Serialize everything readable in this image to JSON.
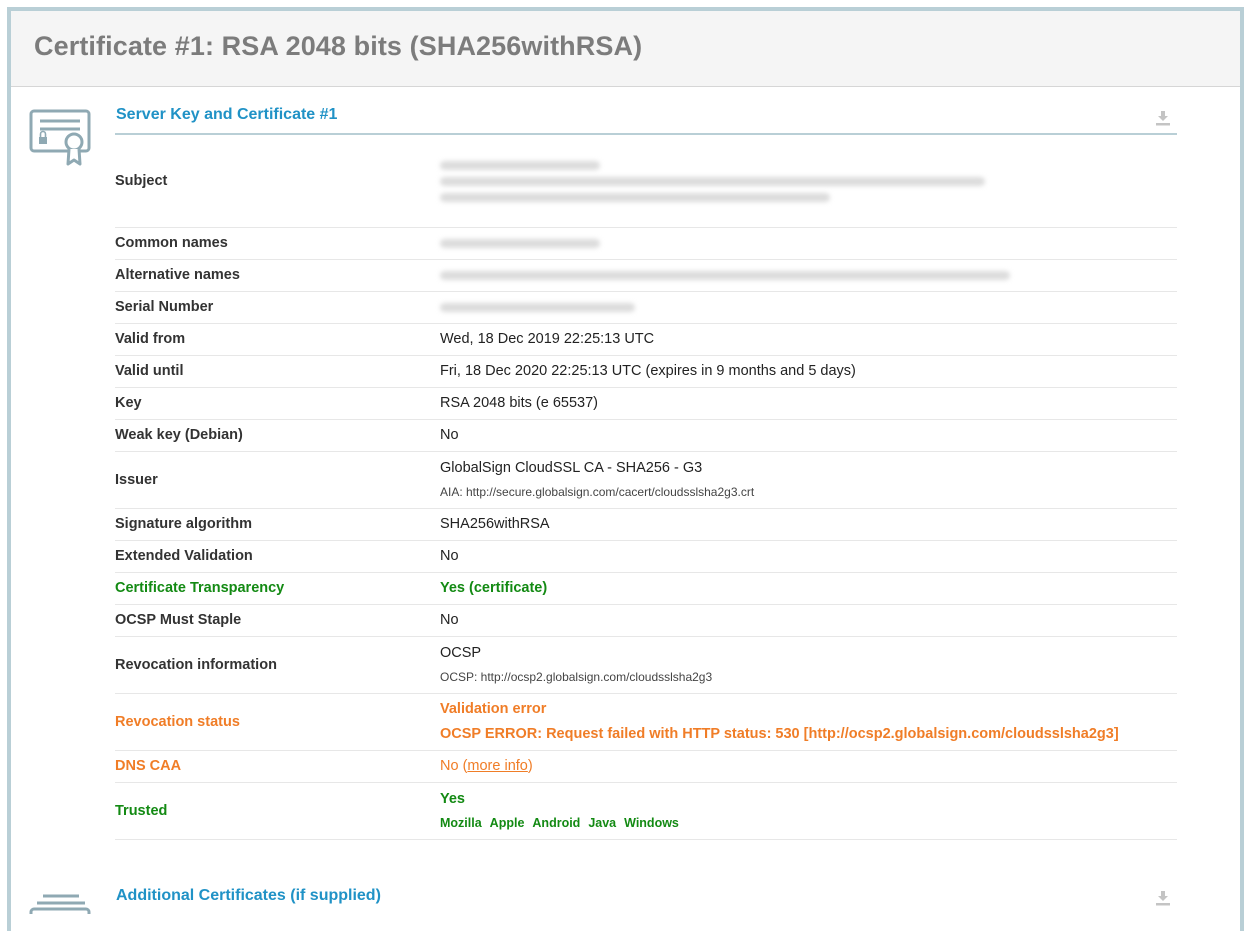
{
  "header": {
    "title": "Certificate #1: RSA 2048 bits (SHA256withRSA)"
  },
  "section": {
    "title": "Server Key and Certificate #1"
  },
  "section2": {
    "title": "Additional Certificates (if supplied)"
  },
  "rows": {
    "subject": {
      "label": "Subject"
    },
    "common_names": {
      "label": "Common names"
    },
    "alternative_names": {
      "label": "Alternative names"
    },
    "serial_number": {
      "label": "Serial Number"
    },
    "valid_from": {
      "label": "Valid from",
      "value": "Wed, 18 Dec 2019 22:25:13 UTC"
    },
    "valid_until": {
      "label": "Valid until",
      "value": "Fri, 18 Dec 2020 22:25:13 UTC (expires in 9 months and 5 days)"
    },
    "key": {
      "label": "Key",
      "value": "RSA 2048 bits (e 65537)"
    },
    "weak_key": {
      "label": "Weak key (Debian)",
      "value": "No"
    },
    "issuer": {
      "label": "Issuer",
      "value": "GlobalSign CloudSSL CA - SHA256 - G3",
      "sub": "AIA: http://secure.globalsign.com/cacert/cloudsslsha2g3.crt"
    },
    "signature_algorithm": {
      "label": "Signature algorithm",
      "value": "SHA256withRSA"
    },
    "extended_validation": {
      "label": "Extended Validation",
      "value": "No"
    },
    "certificate_transparency": {
      "label": "Certificate Transparency",
      "value": "Yes (certificate)"
    },
    "ocsp_must_staple": {
      "label": "OCSP Must Staple",
      "value": "No"
    },
    "revocation_information": {
      "label": "Revocation information",
      "value": "OCSP",
      "sub": "OCSP: http://ocsp2.globalsign.com/cloudsslsha2g3"
    },
    "revocation_status": {
      "label": "Revocation status",
      "value": "Validation error",
      "value2": "OCSP ERROR: Request failed with HTTP status: 530 [http://ocsp2.globalsign.com/cloudsslsha2g3]"
    },
    "dns_caa": {
      "label": "DNS CAA",
      "value_prefix": "No (",
      "link": "more info",
      "value_suffix": ")"
    },
    "trusted": {
      "label": "Trusted",
      "value": "Yes",
      "stores": [
        "Mozilla",
        "Apple",
        "Android",
        "Java",
        "Windows"
      ]
    }
  },
  "colors": {
    "accent": "#2092c6",
    "green": "#138a13",
    "orange": "#f07d27",
    "frame": "#b9cfd6",
    "header_text": "#7c7c7c"
  },
  "icons": {
    "certificate": "certificate-icon",
    "download": "download-icon",
    "stack": "certificate-stack-icon"
  }
}
